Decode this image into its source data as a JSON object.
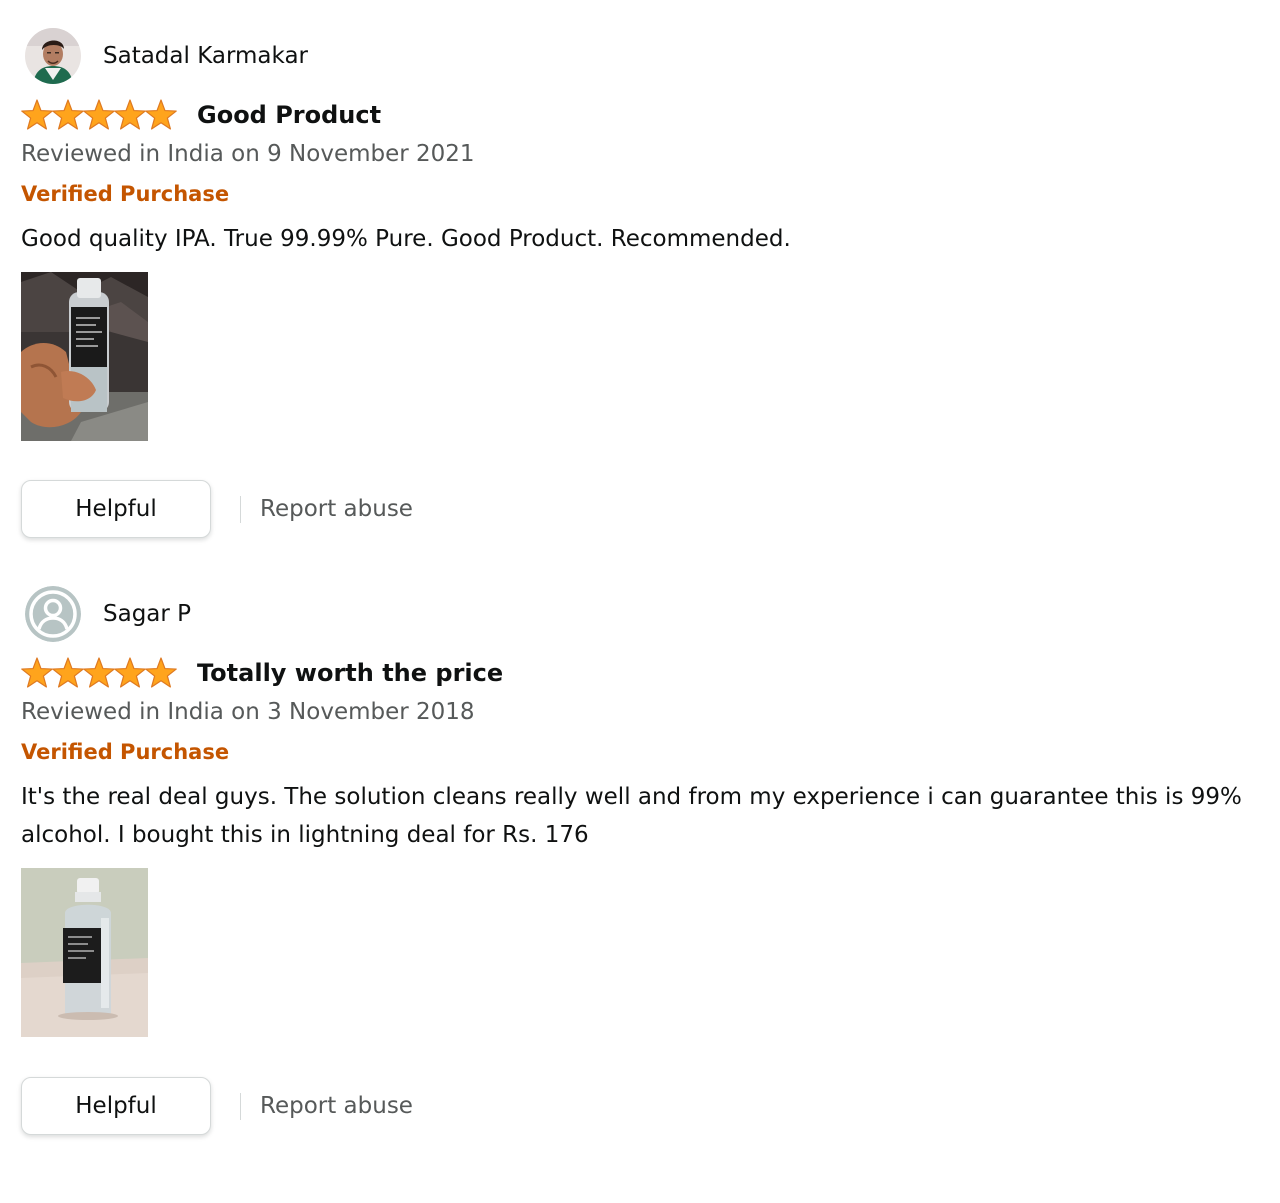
{
  "theme": {
    "star_color": "#ffa41c",
    "verified_color": "#c45500",
    "secondary_text_color": "#565959"
  },
  "reviews": [
    {
      "reviewer_name": "Satadal Karmakar",
      "avatar_icon": "profile-photo",
      "rating": 5,
      "rating_max": 5,
      "title": "Good Product",
      "date": "Reviewed in India on 9 November 2021",
      "verified": "Verified Purchase",
      "body": "Good quality IPA. True 99.99% Pure. Good Product. Recommended.",
      "image_icon": "bottle-in-hand-photo",
      "helpful_label": "Helpful",
      "report_label": "Report abuse"
    },
    {
      "reviewer_name": "Sagar P",
      "avatar_icon": "default-user-icon",
      "rating": 5,
      "rating_max": 5,
      "title": "Totally worth the price",
      "date": "Reviewed in India on 3 November 2018",
      "verified": "Verified Purchase",
      "body": "It's the real deal guys. The solution cleans really well and from my experience i can guarantee this is 99% alcohol. I bought this in lightning deal for Rs. 176",
      "image_icon": "bottle-on-table-photo",
      "helpful_label": "Helpful",
      "report_label": "Report abuse"
    }
  ]
}
